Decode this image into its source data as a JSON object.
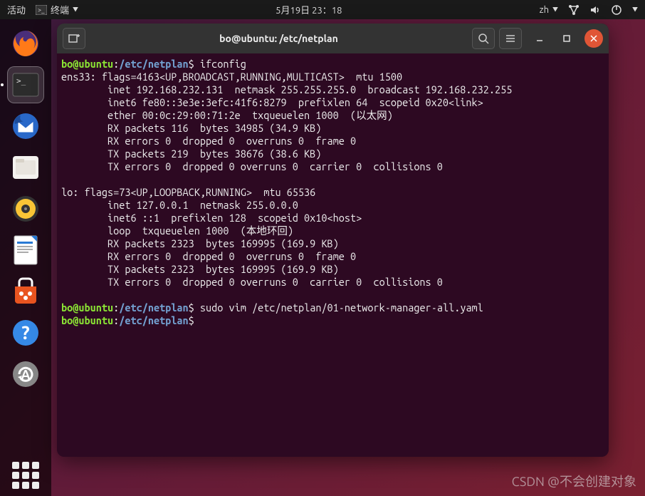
{
  "topbar": {
    "activities": "活动",
    "app_menu": "终端",
    "datetime": "5月19日 23：18",
    "ime": "zh"
  },
  "window": {
    "title": "bo@ubuntu: /etc/netplan"
  },
  "terminal": {
    "prompt_user": "bo@ubuntu",
    "prompt_path": "/etc/netplan",
    "cmd1": "ifconfig",
    "out1_l1": "ens33: flags=4163<UP,BROADCAST,RUNNING,MULTICAST>  mtu 1500",
    "out1_l2": "        inet 192.168.232.131  netmask 255.255.255.0  broadcast 192.168.232.255",
    "out1_l3": "        inet6 fe80::3e3e:3efc:41f6:8279  prefixlen 64  scopeid 0x20<link>",
    "out1_l4": "        ether 00:0c:29:00:71:2e  txqueuelen 1000  (以太网)",
    "out1_l5": "        RX packets 116  bytes 34985 (34.9 KB)",
    "out1_l6": "        RX errors 0  dropped 0  overruns 0  frame 0",
    "out1_l7": "        TX packets 219  bytes 38676 (38.6 KB)",
    "out1_l8": "        TX errors 0  dropped 0 overruns 0  carrier 0  collisions 0",
    "out1_blank1": "",
    "out1_l9": "lo: flags=73<UP,LOOPBACK,RUNNING>  mtu 65536",
    "out1_l10": "        inet 127.0.0.1  netmask 255.0.0.0",
    "out1_l11": "        inet6 ::1  prefixlen 128  scopeid 0x10<host>",
    "out1_l12": "        loop  txqueuelen 1000  (本地环回)",
    "out1_l13": "        RX packets 2323  bytes 169995 (169.9 KB)",
    "out1_l14": "        RX errors 0  dropped 0  overruns 0  frame 0",
    "out1_l15": "        TX packets 2323  bytes 169995 (169.9 KB)",
    "out1_l16": "        TX errors 0  dropped 0 overruns 0  carrier 0  collisions 0",
    "out1_blank2": "",
    "cmd2": "sudo vim /etc/netplan/01-network-manager-all.yaml",
    "cmd3": ""
  },
  "watermark": "CSDN @不会创建对象",
  "dock": {
    "items": [
      "firefox",
      "terminal",
      "thunderbird",
      "files",
      "rhythmbox",
      "libreoffice-writer",
      "software",
      "help",
      "updates"
    ]
  }
}
